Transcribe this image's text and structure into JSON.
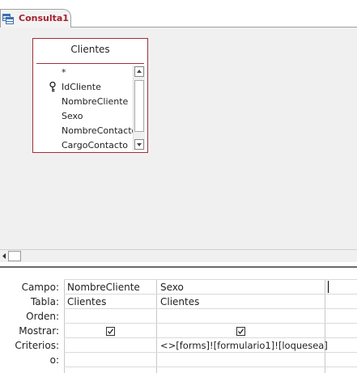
{
  "tab": {
    "label": "Consulta1",
    "icon": "query-design-icon"
  },
  "table_box": {
    "title": "Clientes",
    "fields": [
      {
        "name": "*",
        "key": false
      },
      {
        "name": "IdCliente",
        "key": true
      },
      {
        "name": "NombreCliente",
        "key": false
      },
      {
        "name": "Sexo",
        "key": false
      },
      {
        "name": "NombreContacto",
        "key": false
      },
      {
        "name": "CargoContacto",
        "key": false
      }
    ]
  },
  "grid": {
    "row_labels": {
      "campo": "Campo:",
      "tabla": "Tabla:",
      "orden": "Orden:",
      "mostrar": "Mostrar:",
      "criterios": "Criterios:",
      "o": "o:"
    },
    "columns": [
      {
        "campo": "NombreCliente",
        "tabla": "Clientes",
        "orden": "",
        "mostrar": true,
        "criterios": "",
        "o": ""
      },
      {
        "campo": "Sexo",
        "tabla": "Clientes",
        "orden": "",
        "mostrar": true,
        "criterios": "<>[forms]![formulario1]![loquesea]",
        "o": ""
      },
      {
        "campo": "",
        "tabla": "",
        "orden": "",
        "mostrar": false,
        "criterios": "",
        "o": ""
      }
    ]
  },
  "colors": {
    "accent": "#a52130",
    "box_border": "#a0303a",
    "design_bg": "#f0f0f0"
  }
}
